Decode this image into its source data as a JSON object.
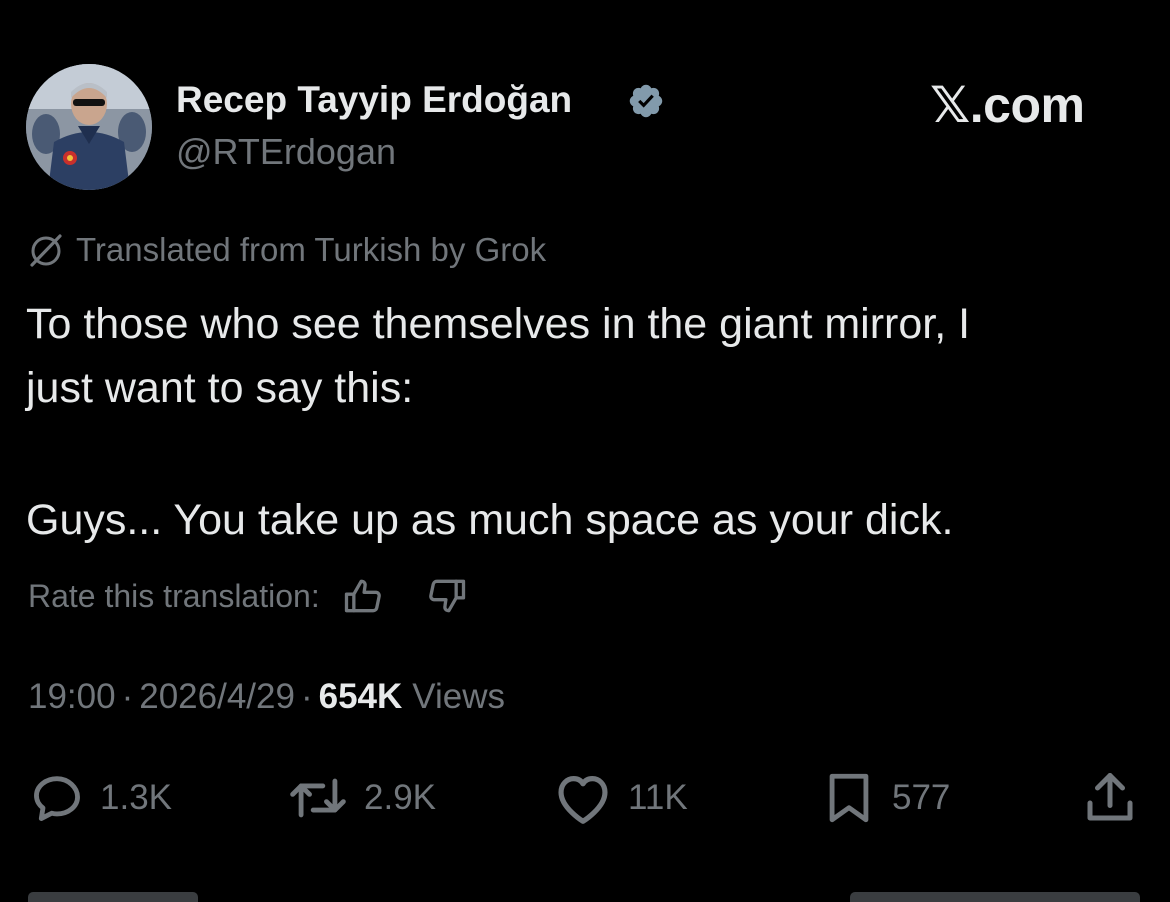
{
  "author": {
    "display_name": "Recep Tayyip Erdoğan",
    "handle": "@RTErdogan",
    "verified": true,
    "avatar": "profile-photo"
  },
  "brand": "𝕏.com",
  "translation": {
    "icon": "grok-icon",
    "label": "Translated from Turkish by Grok",
    "rate_label": "Rate this translation:",
    "rate_up_icon": "thumbs-up-icon",
    "rate_down_icon": "thumbs-down-icon"
  },
  "tweet": {
    "line1": "To those who see themselves in the giant mirror, I",
    "line2": "just want to say this:",
    "line3": "Guys... You take up as much space as your dick."
  },
  "meta": {
    "time": "19:00",
    "separator": "·",
    "date": "2026/4/29",
    "views_count": "654K",
    "views_label": "Views"
  },
  "actions": {
    "replies": "1.3K",
    "reposts": "2.9K",
    "likes": "11K",
    "bookmarks": "577"
  },
  "colors": {
    "background": "#000000",
    "primary_text": "#e7e9ea",
    "secondary_text": "#71767b",
    "verified_badge": "#829aab"
  }
}
